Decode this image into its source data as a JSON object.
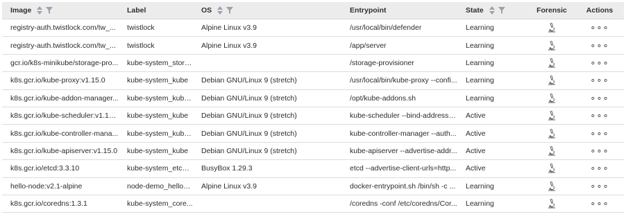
{
  "headers": {
    "image": "Image",
    "label": "Label",
    "os": "OS",
    "entrypoint": "Entrypoint",
    "state": "State",
    "forensic": "Forensic",
    "actions": "Actions"
  },
  "actions_glyph": "∘∘∘",
  "rows": [
    {
      "image": "registry-auth.twistlock.com/tw_...",
      "label": "twistlock",
      "os": "Alpine Linux v3.9",
      "entrypoint": "/usr/local/bin/defender",
      "state": "Learning"
    },
    {
      "image": "registry-auth.twistlock.com/tw_...",
      "label": "twistlock",
      "os": "Alpine Linux v3.9",
      "entrypoint": "/app/server",
      "state": "Learning"
    },
    {
      "image": "gcr.io/k8s-minikube/storage-pro...",
      "label": "kube-system_stora...",
      "os": "",
      "entrypoint": "/storage-provisioner",
      "state": "Learning"
    },
    {
      "image": "k8s.gcr.io/kube-proxy:v1.15.0",
      "label": "kube-system_kube",
      "os": "Debian GNU/Linux 9 (stretch)",
      "entrypoint": "/usr/local/bin/kube-proxy --confi...",
      "state": "Learning"
    },
    {
      "image": "k8s.gcr.io/kube-addon-manager...",
      "label": "kube-system_kube...",
      "os": "Debian GNU/Linux 9 (stretch)",
      "entrypoint": "/opt/kube-addons.sh",
      "state": "Learning"
    },
    {
      "image": "k8s.gcr.io/kube-scheduler:v1.15.0",
      "label": "kube-system_kube",
      "os": "Debian GNU/Linux 9 (stretch)",
      "entrypoint": "kube-scheduler --bind-address=...",
      "state": "Active"
    },
    {
      "image": "k8s.gcr.io/kube-controller-mana...",
      "label": "kube-system_kube...",
      "os": "Debian GNU/Linux 9 (stretch)",
      "entrypoint": "kube-controller-manager --auth...",
      "state": "Active"
    },
    {
      "image": "k8s.gcr.io/kube-apiserver:v1.15.0",
      "label": "kube-system_kube",
      "os": "Debian GNU/Linux 9 (stretch)",
      "entrypoint": "kube-apiserver --advertise-addr...",
      "state": "Active"
    },
    {
      "image": "k8s.gcr.io/etcd:3.3.10",
      "label": "kube-system_etcd-...",
      "os": "BusyBox 1.29.3",
      "entrypoint": "etcd --advertise-client-urls=http...",
      "state": "Active"
    },
    {
      "image": "hello-node:v2.1-alpine",
      "label": "node-demo_hellon...",
      "os": "Alpine Linux v3.9",
      "entrypoint": "docker-entrypoint.sh /bin/sh -c ...",
      "state": "Learning"
    },
    {
      "image": "k8s.gcr.io/coredns:1.3.1",
      "label": "kube-system_core...",
      "os": "",
      "entrypoint": "/coredns -conf /etc/coredns/Cor...",
      "state": "Learning"
    }
  ]
}
